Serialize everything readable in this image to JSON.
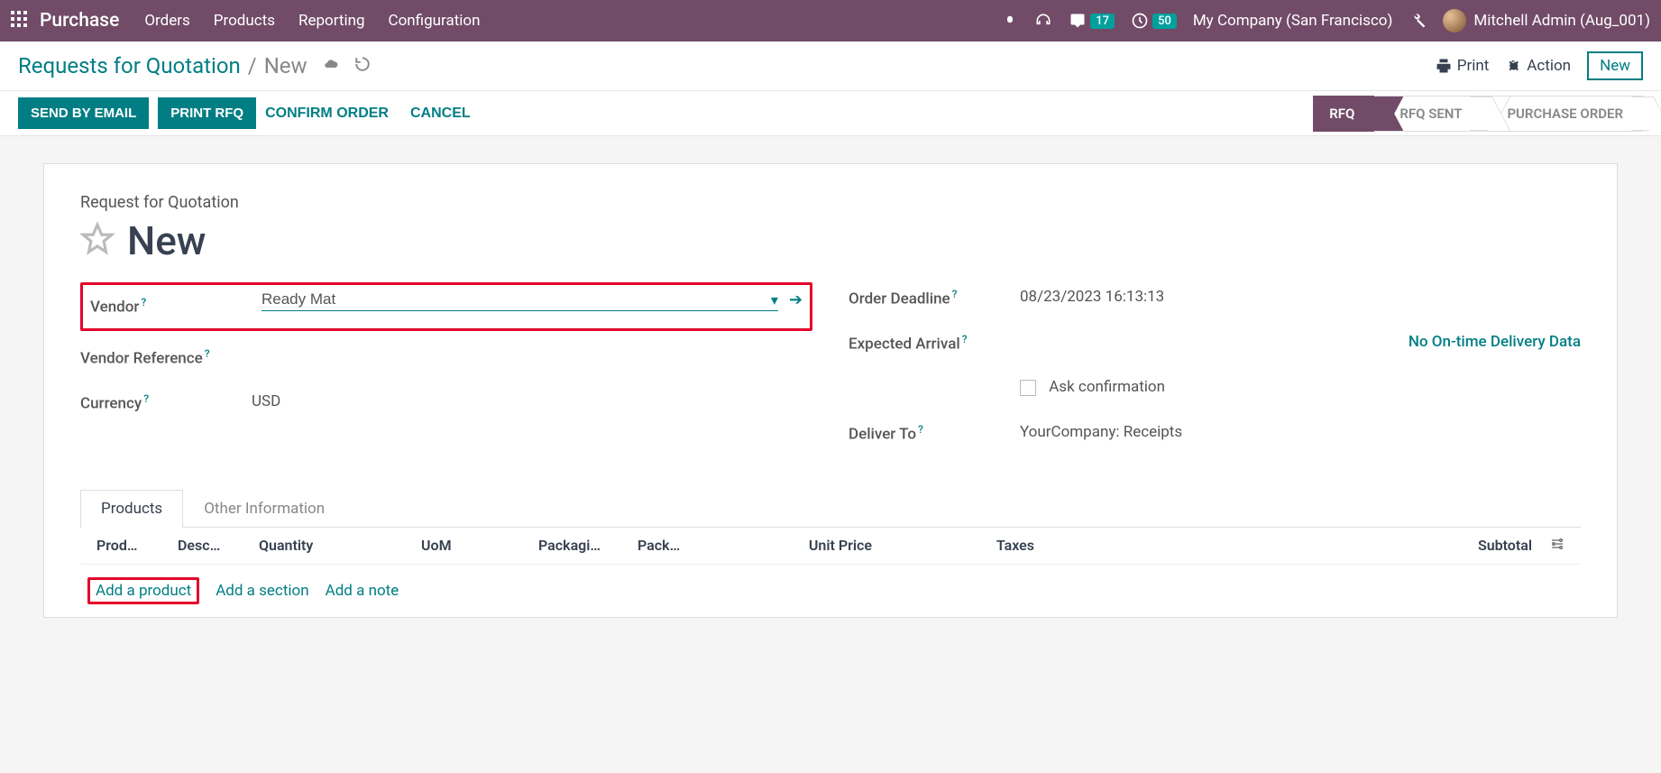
{
  "topbar": {
    "app_name": "Purchase",
    "menu": [
      "Orders",
      "Products",
      "Reporting",
      "Configuration"
    ],
    "msg_count": "17",
    "activity_count": "50",
    "company": "My Company (San Francisco)",
    "user": "Mitchell Admin (Aug_001)"
  },
  "breadcrumb": {
    "back": "Requests for Quotation",
    "current": "New",
    "print": "Print",
    "action": "Action",
    "new": "New"
  },
  "statusbar": {
    "send_email": "SEND BY EMAIL",
    "print_rfq": "PRINT RFQ",
    "confirm": "CONFIRM ORDER",
    "cancel": "CANCEL",
    "steps": [
      "RFQ",
      "RFQ SENT",
      "PURCHASE ORDER"
    ]
  },
  "form": {
    "title_label": "Request for Quotation",
    "title": "New",
    "vendor_label": "Vendor",
    "vendor_value": "Ready Mat",
    "vendor_ref_label": "Vendor Reference",
    "currency_label": "Currency",
    "currency_value": "USD",
    "deadline_label": "Order Deadline",
    "deadline_value": "08/23/2023 16:13:13",
    "arrival_label": "Expected Arrival",
    "arrival_value": "No On-time Delivery Data",
    "ask_confirm": "Ask confirmation",
    "deliver_label": "Deliver To",
    "deliver_value": "YourCompany: Receipts"
  },
  "tabs": {
    "products": "Products",
    "other": "Other Information"
  },
  "table": {
    "headers": [
      "Prod…",
      "Desc…",
      "Quantity",
      "UoM",
      "Packagi…",
      "Pack…",
      "Unit Price",
      "Taxes",
      "Subtotal"
    ],
    "add_product": "Add a product",
    "add_section": "Add a section",
    "add_note": "Add a note"
  }
}
